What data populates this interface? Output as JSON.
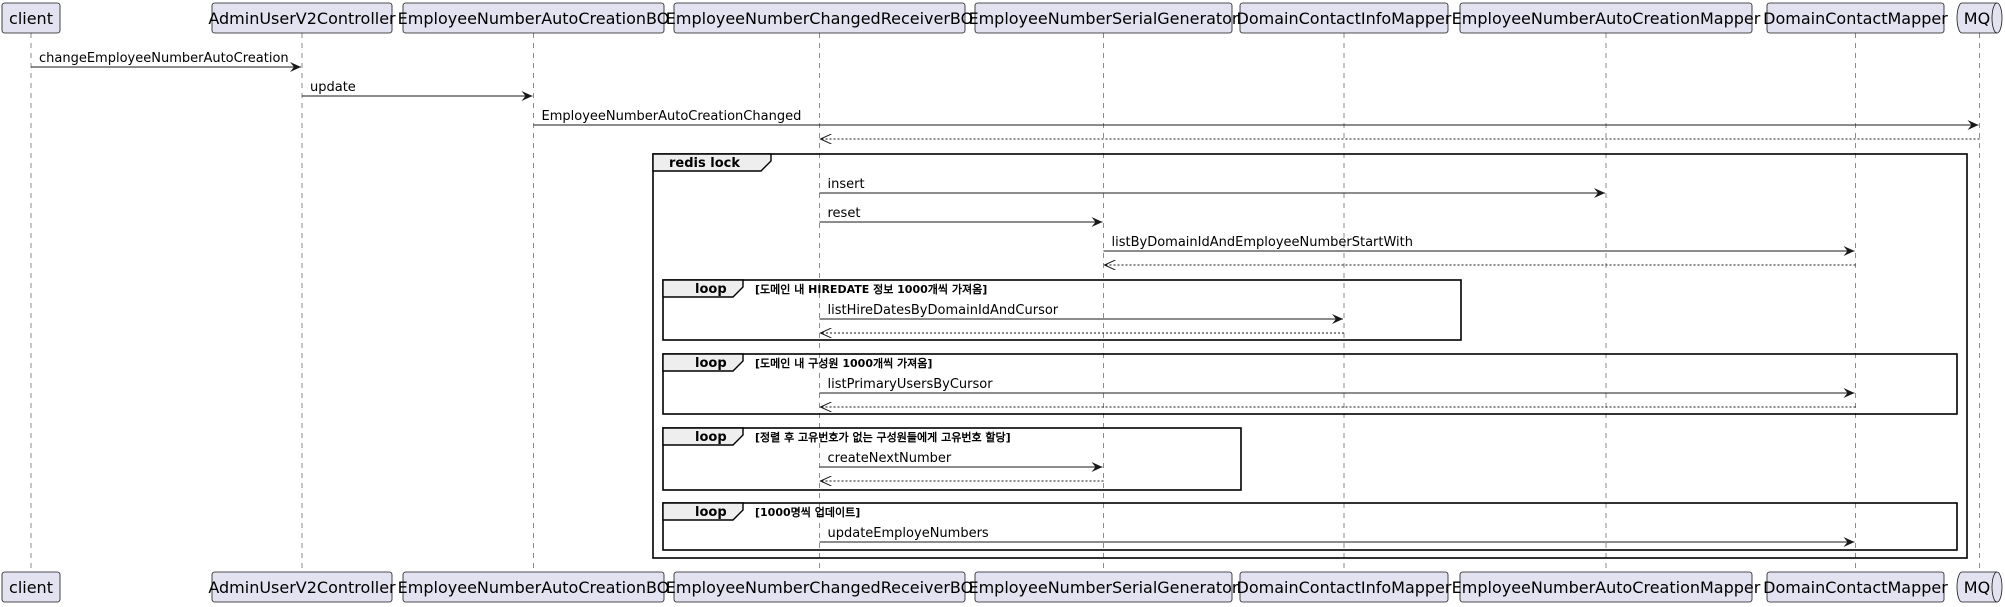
{
  "diagram": {
    "participants": [
      {
        "id": "client",
        "label": "client"
      },
      {
        "id": "ctrl",
        "label": "AdminUserV2Controller"
      },
      {
        "id": "bo",
        "label": "EmployeeNumberAutoCreationBO"
      },
      {
        "id": "recv",
        "label": "EmployeeNumberChangedReceiverBO"
      },
      {
        "id": "gen",
        "label": "EmployeeNumberSerialGenerator"
      },
      {
        "id": "dcim",
        "label": "DomainContactInfoMapper"
      },
      {
        "id": "encm",
        "label": "EmployeeNumberAutoCreationMapper"
      },
      {
        "id": "dcm",
        "label": "DomainContactMapper"
      },
      {
        "id": "mq",
        "label": "MQ",
        "kind": "queue"
      }
    ],
    "messages": [
      {
        "from": "client",
        "to": "ctrl",
        "label": "changeEmployeeNumberAutoCreation"
      },
      {
        "from": "ctrl",
        "to": "bo",
        "label": "update"
      },
      {
        "from": "bo",
        "to": "mq",
        "label": "EmployeeNumberAutoCreationChanged"
      },
      {
        "from": "mq",
        "to": "recv",
        "label": "",
        "dashed": true
      },
      {
        "from": "recv",
        "to": "encm",
        "label": "insert"
      },
      {
        "from": "recv",
        "to": "gen",
        "label": "reset"
      },
      {
        "from": "gen",
        "to": "dcm",
        "label": "listByDomainIdAndEmployeeNumberStartWith"
      },
      {
        "from": "dcm",
        "to": "gen",
        "label": "",
        "dashed": true
      },
      {
        "from": "recv",
        "to": "dcim",
        "label": "listHireDatesByDomainIdAndCursor"
      },
      {
        "from": "dcim",
        "to": "recv",
        "label": "",
        "dashed": true
      },
      {
        "from": "recv",
        "to": "dcm",
        "label": "listPrimaryUsersByCursor"
      },
      {
        "from": "dcm",
        "to": "recv",
        "label": "",
        "dashed": true
      },
      {
        "from": "recv",
        "to": "gen",
        "label": "createNextNumber"
      },
      {
        "from": "gen",
        "to": "recv",
        "label": "",
        "dashed": true
      },
      {
        "from": "recv",
        "to": "dcm",
        "label": "updateEmployeNumbers"
      }
    ],
    "frames": [
      {
        "title": "redis lock",
        "condition": ""
      },
      {
        "title": "loop",
        "condition": "[도메인 내 HIREDATE 정보 1000개씩 가져옴]"
      },
      {
        "title": "loop",
        "condition": "[도메인 내 구성원 1000개씩 가져옴]"
      },
      {
        "title": "loop",
        "condition": "[정렬 후 고유번호가 없는 구성원들에게 고유번호 할당]"
      },
      {
        "title": "loop",
        "condition": "[1000명씩 업데이트]"
      }
    ]
  },
  "colors": {
    "participant_fill": "#E2E2F0",
    "participant_stroke": "#181818",
    "lifeline": "#181818",
    "frame_header": "#EEEEEE"
  }
}
